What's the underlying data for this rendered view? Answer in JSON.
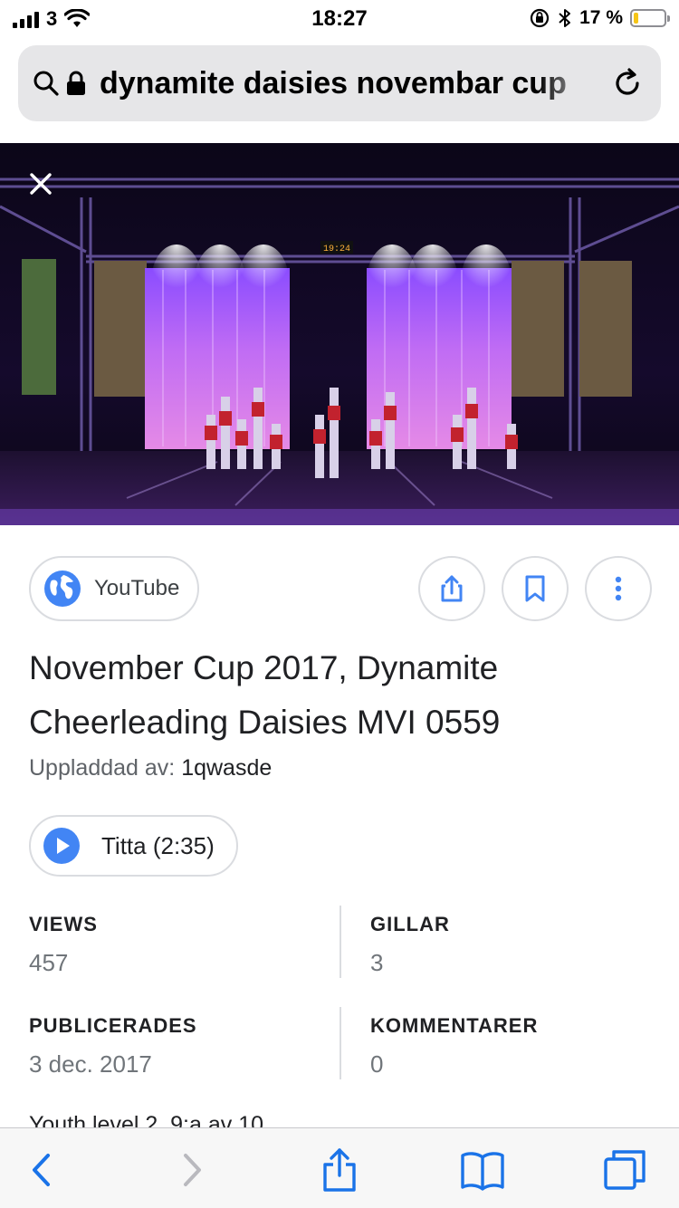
{
  "status_bar": {
    "carrier": "3",
    "time": "18:27",
    "battery_percent": "17 %",
    "battery_level": 0.17
  },
  "browser": {
    "url_text": "dynamite daisies novembar cup"
  },
  "media": {
    "scoreboard_text": "19:24"
  },
  "source": {
    "site_name": "YouTube"
  },
  "result": {
    "title": "November Cup 2017, Dynamite Cheerleading Daisies MVI 0559",
    "uploader_label": "Uppladdad av:",
    "uploader_name": "1qwasde",
    "watch_label": "Titta (2:35)"
  },
  "stats": {
    "views_label": "VIEWS",
    "views_value": "457",
    "likes_label": "GILLAR",
    "likes_value": "3",
    "published_label": "PUBLICERADES",
    "published_value": "3 dec. 2017",
    "comments_label": "KOMMENTARER",
    "comments_value": "0"
  },
  "description": "Youth level 2, 9:a av 10",
  "colors": {
    "accent_blue": "#4285f4",
    "ios_blue": "#1a73e8",
    "battery_yellow": "#f5c518"
  }
}
